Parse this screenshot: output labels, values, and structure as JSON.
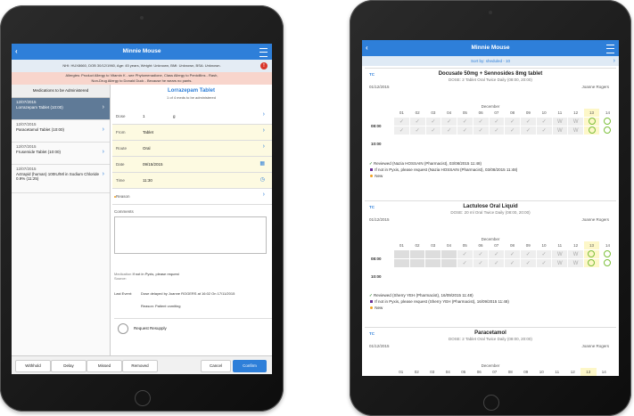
{
  "left_tablet": {
    "header": {
      "back": "‹",
      "title": "Minnie Mouse"
    },
    "patient_info": "NHI: HUX8660, DOB 30/12/1960, Age: 45 years, Weight: Unknown, BMI: Unknown, BSA: Unknown.",
    "alert_icon": "!",
    "allergies_line1": "Allergies: Product Allergy to Vitamin K - see Phytomenadione, Class Allergy to Penicillins - Rash,",
    "allergies_line2": "Non-Drug Allergy to Donald Duck - Because he wears no pants.",
    "list_header": "Medications to be Administered",
    "meds": [
      {
        "date": "12/07/2015",
        "name": "Lorrazepam Tablet (10:00)"
      },
      {
        "date": "12/07/2015",
        "name": "Paracetamol Tablet (10:00)"
      },
      {
        "date": "12/07/2015",
        "name": "Frusemide Tablet (10:00)"
      },
      {
        "date": "12/07/2015",
        "name": "Actrapid (human) 100IU/Ml in Sodium Chloride 0.9% (11:25)"
      }
    ],
    "detail": {
      "title": "Lorrazepam Tablet",
      "subtitle": "1 of 4 meds to be administered",
      "dose_label": "Dose",
      "dose_value": "1",
      "dose_unit": "g",
      "from_label": "From",
      "from_value": "Tablet",
      "route_label": "Route",
      "route_value": "Oral",
      "date_label": "Date",
      "date_value": "09/15/2015",
      "time_label": "Time",
      "time_value": "11:30",
      "reason_label": "Reason",
      "comments_label": "Comments",
      "medication_label": "Medication",
      "medication_note": "If not in Pyxis, please request",
      "source_label": "Source:",
      "last_event_label": "Last Event:",
      "last_event_text": "Dose delayed by Joanne ROGERS at 16:02 On 17/11/2015",
      "last_event_reason": "Reason: Patient vomiting",
      "resupply_label": "Request Resupply"
    },
    "footer": {
      "withhold": "Withhold",
      "delay": "Delay",
      "missed": "Missed",
      "removed": "Removed",
      "cancel": "Cancel",
      "confirm": "Confirm"
    }
  },
  "right_tablet": {
    "header": {
      "back": "‹",
      "title": "Minnie Mouse"
    },
    "sort_label": "Sort by: sheduled - 10",
    "days": [
      "01",
      "02",
      "03",
      "04",
      "05",
      "06",
      "07",
      "08",
      "09",
      "10",
      "11",
      "12",
      "13",
      "14"
    ],
    "cards": [
      {
        "tc": "TC",
        "title": "Docusate 50mg + Sennosides 8mg tablet",
        "dose": "DOSE: 2 Tablet Oral Twice Daily (08:00, 20:00)",
        "date": "01/12/2015",
        "nurse": "Joanne Rogers",
        "month": "December",
        "times": [
          "08:00",
          "10:00"
        ],
        "reviewed": "Reviewed (Nazia HOSSAIN (Pharmacist), 03/08/2015 11:48)",
        "pyxis": "If not in Pyxis, please request (Nazia HOSSAIN (Pharmacist), 03/08/2015 11:48)",
        "new": "New"
      },
      {
        "tc": "TC",
        "title": "Lactulose Oral Liquid",
        "dose": "DOSE: 20 ml Oral Twice Daily (08:00, 20:00)",
        "date": "01/12/2015",
        "nurse": "Joanne Rogers",
        "month": "December",
        "times": [
          "08:00",
          "10:00"
        ],
        "reviewed": "Reviewed (Sherry YEH (Pharmacist), 16/09/2015 11:48)",
        "pyxis": "If not in Pyxis, please request (Sherry YEH (Pharmacist), 16/09/2015 11:48)",
        "new": "New"
      },
      {
        "tc": "TC",
        "title": "Paracetamol",
        "dose": "DOSE: 2 Tablet Oral Twice Daily (08:00, 20:00)",
        "date": "01/12/2015",
        "nurse": "Joanne Rogers",
        "month": "December"
      }
    ]
  }
}
